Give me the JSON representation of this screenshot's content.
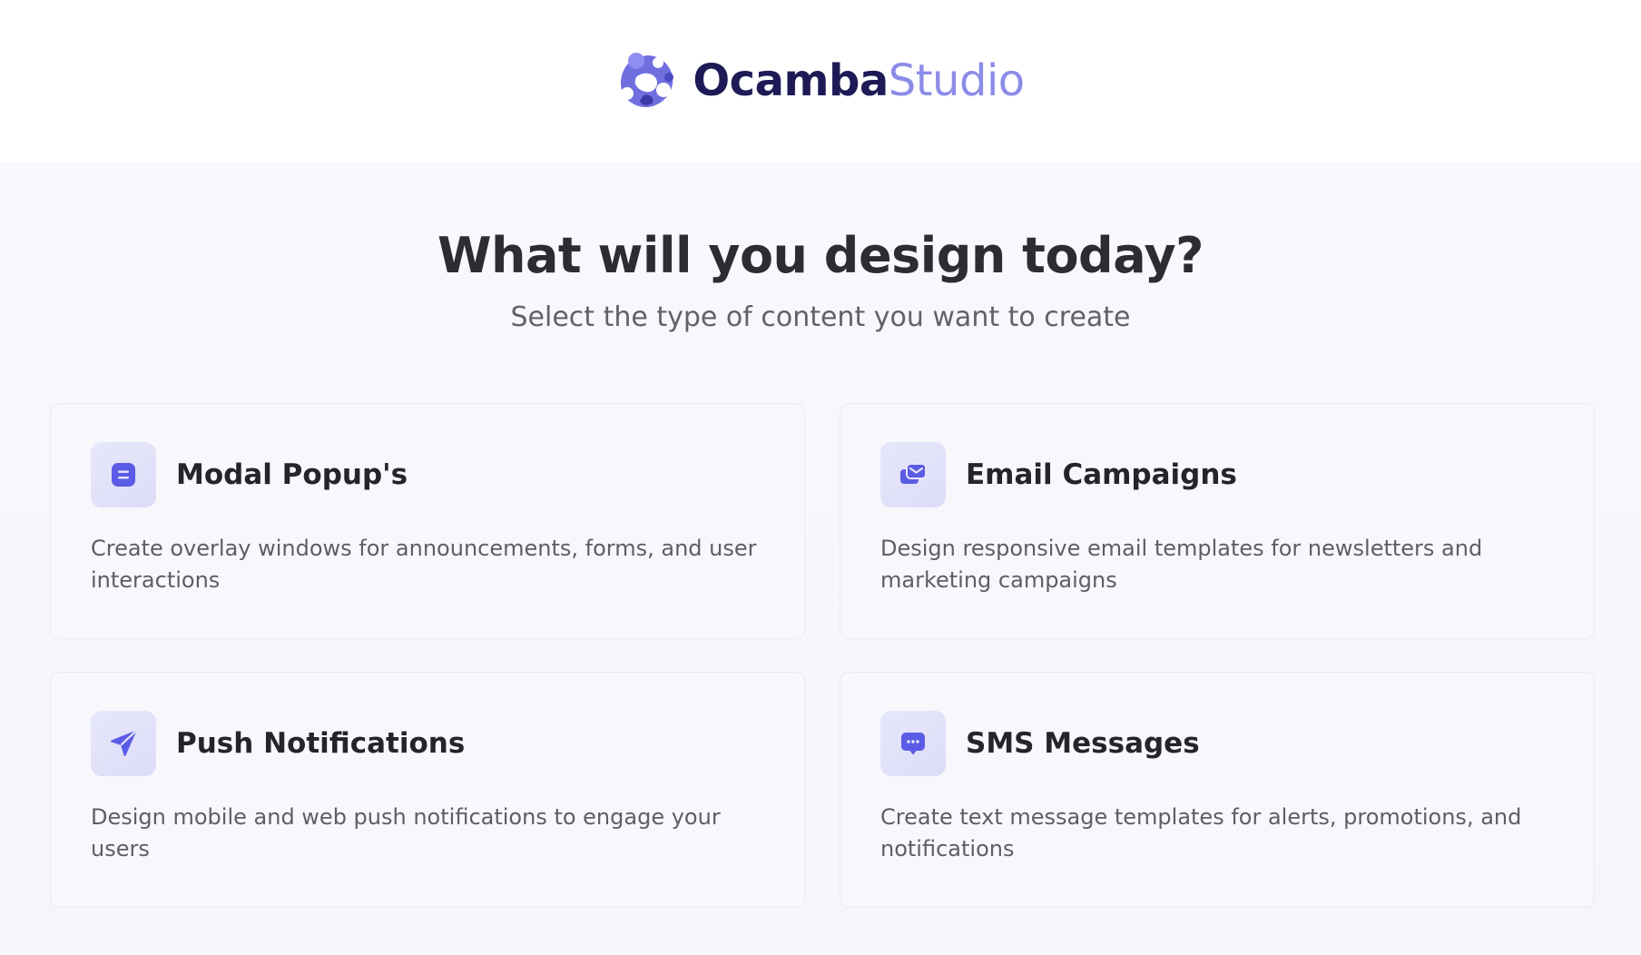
{
  "brand": {
    "name_primary": "Ocamba",
    "name_secondary": "Studio"
  },
  "colors": {
    "brand_dark": "#1d1a55",
    "brand_light": "#8b8ce8",
    "accent": "#5b5ce6",
    "icon_bg": "#e3e3fa"
  },
  "hero": {
    "title": "What will you design today?",
    "subtitle": "Select the type of content you want to create"
  },
  "cards": [
    {
      "icon": "modal-popup-icon",
      "title": "Modal Popup's",
      "description": "Create overlay windows for announcements, forms, and user interactions"
    },
    {
      "icon": "email-campaign-icon",
      "title": "Email Campaigns",
      "description": "Design responsive email templates for newsletters and marketing campaigns"
    },
    {
      "icon": "push-notification-icon",
      "title": "Push Notifications",
      "description": "Design mobile and web push notifications to engage your users"
    },
    {
      "icon": "sms-message-icon",
      "title": "SMS Messages",
      "description": "Create text message templates for alerts, promotions, and notifications"
    }
  ]
}
